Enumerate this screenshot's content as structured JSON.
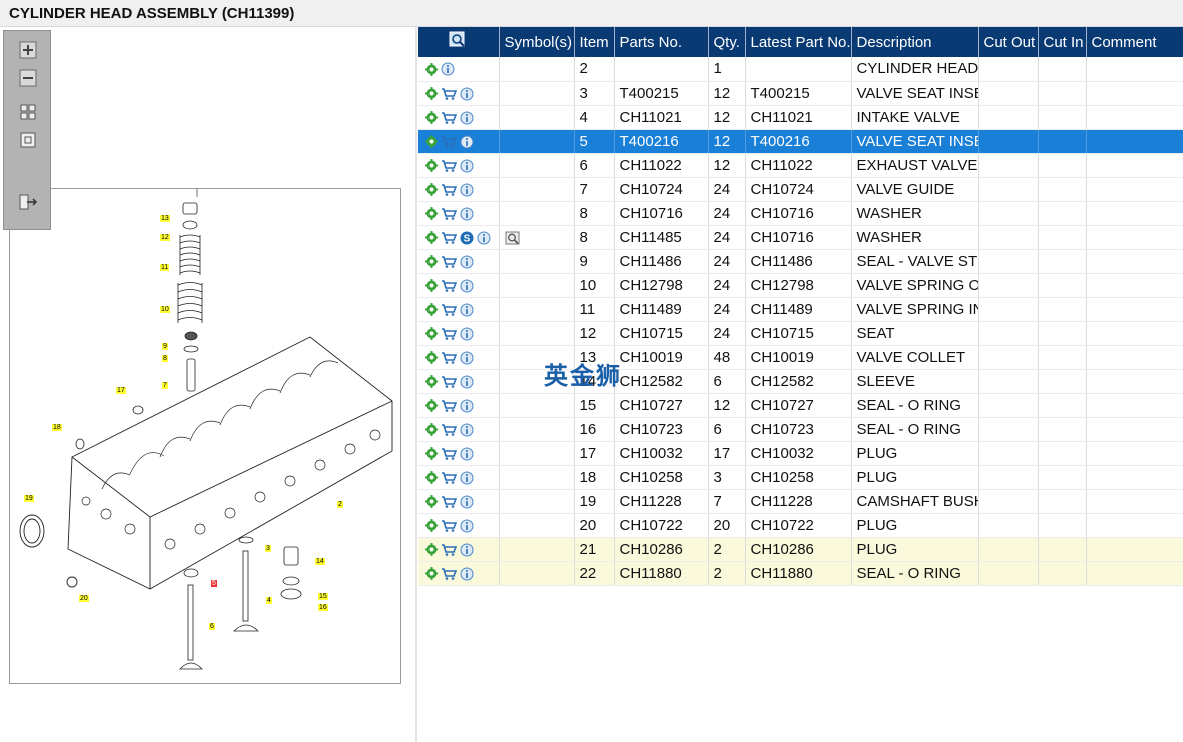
{
  "window": {
    "title": "CYLINDER HEAD ASSEMBLY (CH11399)"
  },
  "watermark": "英金狮",
  "toolbar": {
    "buttons": [
      "zoom-in",
      "zoom-out",
      "fit-all",
      "fit-page",
      "export"
    ]
  },
  "diagram": {
    "callouts": [
      "1",
      "2",
      "3",
      "4",
      "5",
      "6",
      "7",
      "8",
      "9",
      "10",
      "11",
      "12",
      "13",
      "14",
      "15",
      "16",
      "17",
      "18",
      "19",
      "20"
    ],
    "highlighted_callout": "5"
  },
  "table": {
    "headers": [
      "",
      "Symbol(s)",
      "Item",
      "Parts No.",
      "Qty.",
      "Latest Part No.",
      "Description",
      "Cut Out",
      "Cut In",
      "Comment"
    ],
    "rows": [
      {
        "icons": [
          "gear",
          "info"
        ],
        "symbols": [],
        "item": "2",
        "part": "",
        "qty": "1",
        "latest": "",
        "desc": "CYLINDER HEAD",
        "state": ""
      },
      {
        "icons": [
          "gear",
          "cart",
          "info"
        ],
        "symbols": [],
        "item": "3",
        "part": "T400215",
        "qty": "12",
        "latest": "T400215",
        "desc": "VALVE SEAT INSERT",
        "state": ""
      },
      {
        "icons": [
          "gear",
          "cart",
          "info"
        ],
        "symbols": [],
        "item": "4",
        "part": "CH11021",
        "qty": "12",
        "latest": "CH11021",
        "desc": "INTAKE VALVE",
        "state": ""
      },
      {
        "icons": [
          "gear",
          "cart",
          "info"
        ],
        "symbols": [],
        "item": "5",
        "part": "T400216",
        "qty": "12",
        "latest": "T400216",
        "desc": "VALVE SEAT INSERT",
        "state": "selected"
      },
      {
        "icons": [
          "gear",
          "cart",
          "info"
        ],
        "symbols": [],
        "item": "6",
        "part": "CH11022",
        "qty": "12",
        "latest": "CH11022",
        "desc": "EXHAUST VALVE",
        "state": ""
      },
      {
        "icons": [
          "gear",
          "cart",
          "info"
        ],
        "symbols": [],
        "item": "7",
        "part": "CH10724",
        "qty": "24",
        "latest": "CH10724",
        "desc": "VALVE GUIDE",
        "state": ""
      },
      {
        "icons": [
          "gear",
          "cart",
          "info"
        ],
        "symbols": [],
        "item": "8",
        "part": "CH10716",
        "qty": "24",
        "latest": "CH10716",
        "desc": "WASHER",
        "state": ""
      },
      {
        "icons": [
          "gear",
          "cart",
          "s-badge",
          "info"
        ],
        "symbols": [
          "magnifier"
        ],
        "item": "8",
        "part": "CH11485",
        "qty": "24",
        "latest": "CH10716",
        "desc": "WASHER",
        "state": ""
      },
      {
        "icons": [
          "gear",
          "cart",
          "info"
        ],
        "symbols": [],
        "item": "9",
        "part": "CH11486",
        "qty": "24",
        "latest": "CH11486",
        "desc": "SEAL - VALVE STEM",
        "state": ""
      },
      {
        "icons": [
          "gear",
          "cart",
          "info"
        ],
        "symbols": [],
        "item": "10",
        "part": "CH12798",
        "qty": "24",
        "latest": "CH12798",
        "desc": "VALVE SPRING OUTER",
        "state": ""
      },
      {
        "icons": [
          "gear",
          "cart",
          "info"
        ],
        "symbols": [],
        "item": "11",
        "part": "CH11489",
        "qty": "24",
        "latest": "CH11489",
        "desc": "VALVE SPRING INNER",
        "state": ""
      },
      {
        "icons": [
          "gear",
          "cart",
          "info"
        ],
        "symbols": [],
        "item": "12",
        "part": "CH10715",
        "qty": "24",
        "latest": "CH10715",
        "desc": "SEAT",
        "state": ""
      },
      {
        "icons": [
          "gear",
          "cart",
          "info"
        ],
        "symbols": [],
        "item": "13",
        "part": "CH10019",
        "qty": "48",
        "latest": "CH10019",
        "desc": "VALVE COLLET",
        "state": ""
      },
      {
        "icons": [
          "gear",
          "cart",
          "info"
        ],
        "symbols": [],
        "item": "14",
        "part": "CH12582",
        "qty": "6",
        "latest": "CH12582",
        "desc": "SLEEVE",
        "state": ""
      },
      {
        "icons": [
          "gear",
          "cart",
          "info"
        ],
        "symbols": [],
        "item": "15",
        "part": "CH10727",
        "qty": "12",
        "latest": "CH10727",
        "desc": "SEAL - O RING",
        "state": ""
      },
      {
        "icons": [
          "gear",
          "cart",
          "info"
        ],
        "symbols": [],
        "item": "16",
        "part": "CH10723",
        "qty": "6",
        "latest": "CH10723",
        "desc": "SEAL - O RING",
        "state": ""
      },
      {
        "icons": [
          "gear",
          "cart",
          "info"
        ],
        "symbols": [],
        "item": "17",
        "part": "CH10032",
        "qty": "17",
        "latest": "CH10032",
        "desc": "PLUG",
        "state": ""
      },
      {
        "icons": [
          "gear",
          "cart",
          "info"
        ],
        "symbols": [],
        "item": "18",
        "part": "CH10258",
        "qty": "3",
        "latest": "CH10258",
        "desc": "PLUG",
        "state": ""
      },
      {
        "icons": [
          "gear",
          "cart",
          "info"
        ],
        "symbols": [],
        "item": "19",
        "part": "CH11228",
        "qty": "7",
        "latest": "CH11228",
        "desc": "CAMSHAFT BUSH",
        "state": ""
      },
      {
        "icons": [
          "gear",
          "cart",
          "info"
        ],
        "symbols": [],
        "item": "20",
        "part": "CH10722",
        "qty": "20",
        "latest": "CH10722",
        "desc": "PLUG",
        "state": ""
      },
      {
        "icons": [
          "gear",
          "cart",
          "info"
        ],
        "symbols": [],
        "item": "21",
        "part": "CH10286",
        "qty": "2",
        "latest": "CH10286",
        "desc": "PLUG",
        "state": "highlight"
      },
      {
        "icons": [
          "gear",
          "cart",
          "info"
        ],
        "symbols": [],
        "item": "22",
        "part": "CH11880",
        "qty": "2",
        "latest": "CH11880",
        "desc": "SEAL - O RING",
        "state": "highlight"
      }
    ]
  }
}
